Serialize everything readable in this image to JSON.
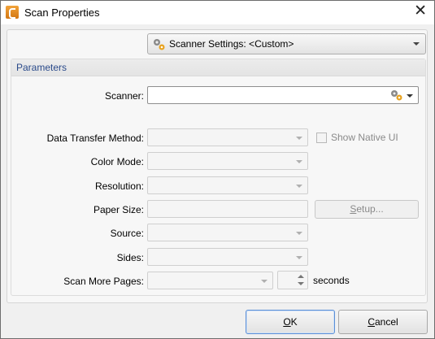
{
  "window": {
    "title": "Scan Properties",
    "close_glyph": "✕",
    "icon": "app-icon-orange"
  },
  "scanner_settings": {
    "label": "Scanner Settings:  <Custom>",
    "icon": "gear-icon"
  },
  "parameters": {
    "group_title": "Parameters",
    "scanner": {
      "label": "Scanner:",
      "value": ""
    },
    "data_transfer_method": {
      "label": "Data Transfer Method:",
      "value": ""
    },
    "show_native_ui": {
      "label": "Show Native UI",
      "checked": false
    },
    "color_mode": {
      "label": "Color Mode:",
      "value": ""
    },
    "resolution": {
      "label": "Resolution:",
      "value": ""
    },
    "paper_size": {
      "label": "Paper Size:",
      "value": ""
    },
    "setup_button": {
      "label_prefix": "",
      "label_underlined": "S",
      "label_rest": "etup..."
    },
    "source": {
      "label": "Source:",
      "value": ""
    },
    "sides": {
      "label": "Sides:",
      "value": ""
    },
    "scan_more_pages": {
      "label": "Scan More Pages:",
      "value": "",
      "seconds_value": "",
      "seconds_label": "seconds"
    }
  },
  "buttons": {
    "ok": {
      "underlined": "O",
      "rest": "K"
    },
    "cancel": {
      "underlined": "C",
      "rest": "ancel"
    }
  }
}
